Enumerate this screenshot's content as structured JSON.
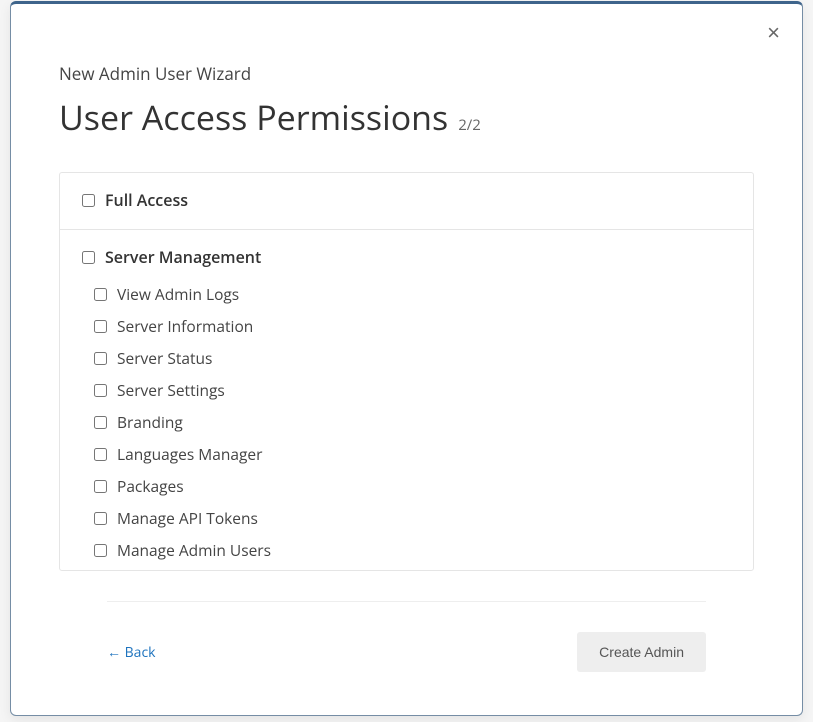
{
  "wizard_label": "New Admin User Wizard",
  "title": "User Access Permissions",
  "step": "2/2",
  "full_access_label": "Full Access",
  "sections": [
    {
      "label": "Server Management",
      "items": [
        "View Admin Logs",
        "Server Information",
        "Server Status",
        "Server Settings",
        "Branding",
        "Languages Manager",
        "Packages",
        "Manage API Tokens",
        "Manage Admin Users"
      ]
    }
  ],
  "back_label": "← Back",
  "create_label": "Create Admin",
  "close_glyph": "×"
}
